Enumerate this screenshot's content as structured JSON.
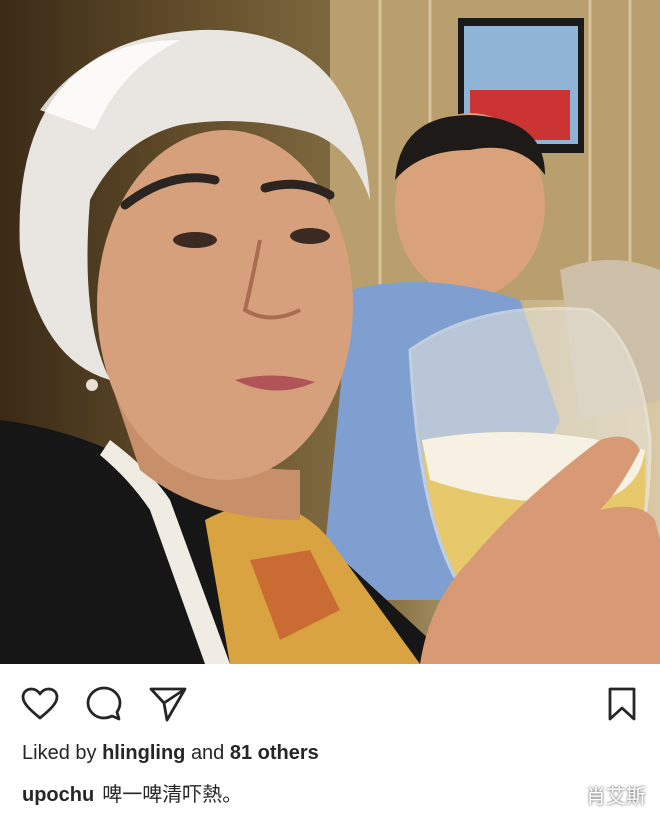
{
  "post": {
    "photo_alt": "Elderly woman with white hair raising a glass of beer at a restaurant table",
    "likes": {
      "prefix": "Liked by",
      "user": "hlingling",
      "middle": "and",
      "others": "81 others"
    },
    "caption": {
      "user": "upochu",
      "text": "啤一啤清吓熱。"
    },
    "watermark": "肖艾斯"
  },
  "actions": {
    "like_icon": "heart-icon",
    "comment_icon": "comment-icon",
    "share_icon": "paper-plane-icon",
    "save_icon": "bookmark-icon"
  }
}
